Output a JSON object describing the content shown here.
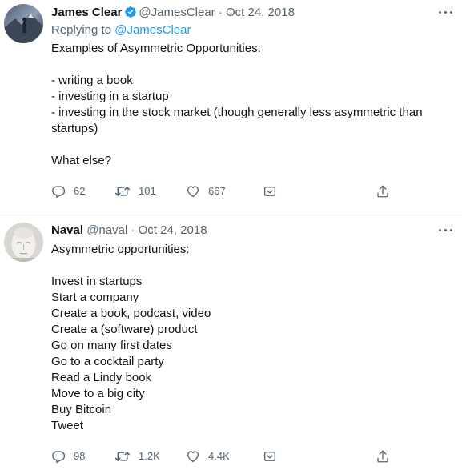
{
  "tweets": [
    {
      "author_name": "James Clear",
      "verified": true,
      "handle": "@JamesClear",
      "separator": "·",
      "date": "Oct 24, 2018",
      "replying_to_label": "Replying to",
      "replying_to_handle": "@JamesClear",
      "text": "Examples of Asymmetric Opportunities:\n\n- writing a book\n- investing in a startup\n- investing in the stock market (though generally less asymmetric than startups)\n\nWhat else?",
      "replies": "62",
      "retweets": "101",
      "likes": "667"
    },
    {
      "author_name": "Naval",
      "verified": false,
      "handle": "@naval",
      "separator": "·",
      "date": "Oct 24, 2018",
      "text": "Asymmetric opportunities:\n\nInvest in startups\nStart a company\nCreate a book, podcast, video\nCreate a (software) product\nGo on many first dates\nGo to a cocktail party\nRead a Lindy book\nMove to a big city\nBuy Bitcoin\nTweet",
      "replies": "98",
      "retweets": "1.2K",
      "likes": "4.4K"
    }
  ],
  "icons": {
    "more": "more-icon",
    "reply": "reply-icon",
    "retweet": "retweet-icon",
    "like": "like-icon",
    "dm": "dm-icon",
    "share": "share-icon",
    "verified": "verified-badge-icon"
  },
  "colors": {
    "text_primary": "#0f1419",
    "text_secondary": "#536471",
    "link": "#1d9bf0",
    "verified": "#1d9bf0",
    "divider": "#eff3f4"
  }
}
